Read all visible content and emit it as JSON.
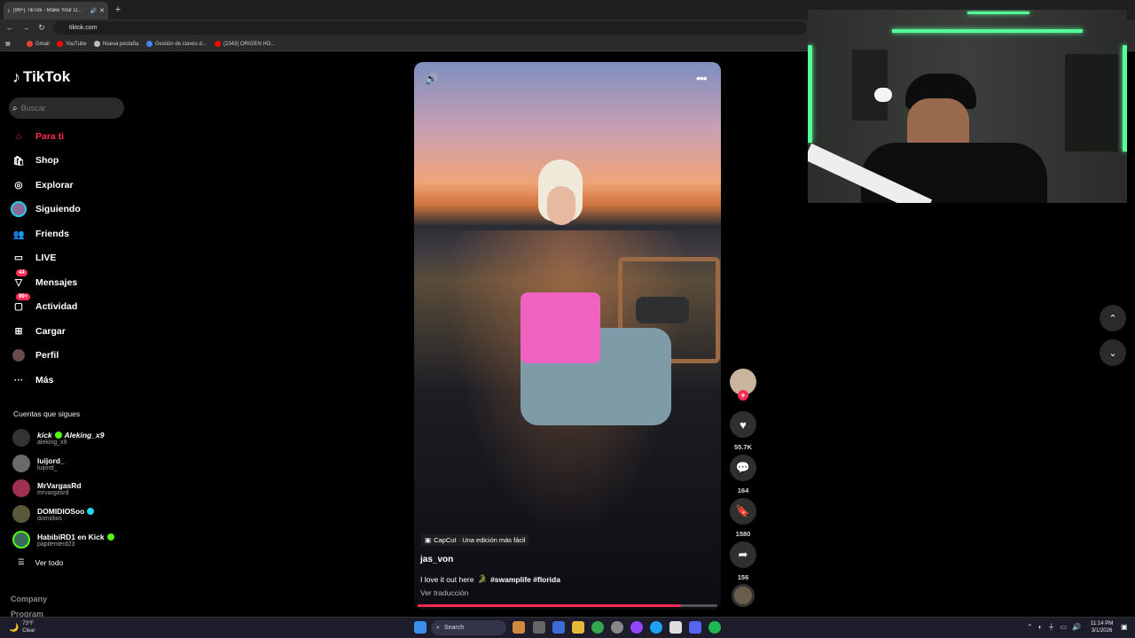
{
  "browser": {
    "tab_title": "(99+) TikTok - Make Your D...",
    "url": "tiktok.com",
    "bookmarks": [
      "Gmail",
      "YouTube",
      "Nueva pestaña",
      "Gestión de claves d...",
      "(2343) ORIGEN HO..."
    ]
  },
  "sidebar": {
    "logo": "TikTok",
    "search_placeholder": "Buscar",
    "nav": [
      {
        "label": "Para ti",
        "icon": "home-icon"
      },
      {
        "label": "Shop",
        "icon": "shop-icon"
      },
      {
        "label": "Explorar",
        "icon": "compass-icon"
      },
      {
        "label": "Siguiendo",
        "icon": "following-avatar-icon"
      },
      {
        "label": "Friends",
        "icon": "friends-icon"
      },
      {
        "label": "LIVE",
        "icon": "live-icon"
      },
      {
        "label": "Mensajes",
        "icon": "messages-icon",
        "badge": "44"
      },
      {
        "label": "Actividad",
        "icon": "activity-icon",
        "badge": "99+"
      },
      {
        "label": "Cargar",
        "icon": "upload-icon"
      },
      {
        "label": "Perfil",
        "icon": "profile-icon"
      },
      {
        "label": "Más",
        "icon": "more-icon"
      }
    ],
    "following_title": "Cuentas que sigues",
    "accounts": [
      {
        "name": "kick",
        "extra": "Aleking_x9",
        "user": "aleking_x9"
      },
      {
        "name": "luijord_",
        "user": "luijord_"
      },
      {
        "name": "MrVargasRd",
        "user": "mrvargasrd"
      },
      {
        "name": "DOMIDIOSoo",
        "user": "domidios"
      },
      {
        "name": "HabibiRD1 en Kick",
        "user": "papilenterd23"
      }
    ],
    "see_all": "Ver todo",
    "footer": [
      "Company",
      "Program"
    ]
  },
  "video": {
    "capcut": "CapCut · Una edición más fácil",
    "author": "jas_von",
    "caption": "I love it out here",
    "hashtags": "#swamplife #florida",
    "translate": "Ver traducción",
    "progress": 0.88
  },
  "actions": {
    "likes": "55.7K",
    "comments": "164",
    "saves": "1580",
    "shares": "156"
  },
  "taskbar": {
    "weather_temp": "73°F",
    "weather_desc": "Clear",
    "search": "Search",
    "time": "11:14 PM",
    "date": "3/1/2026"
  },
  "colors": {
    "accent": "#fe2c55",
    "kick_green": "#53fc18",
    "verified": "#20d5ec"
  }
}
